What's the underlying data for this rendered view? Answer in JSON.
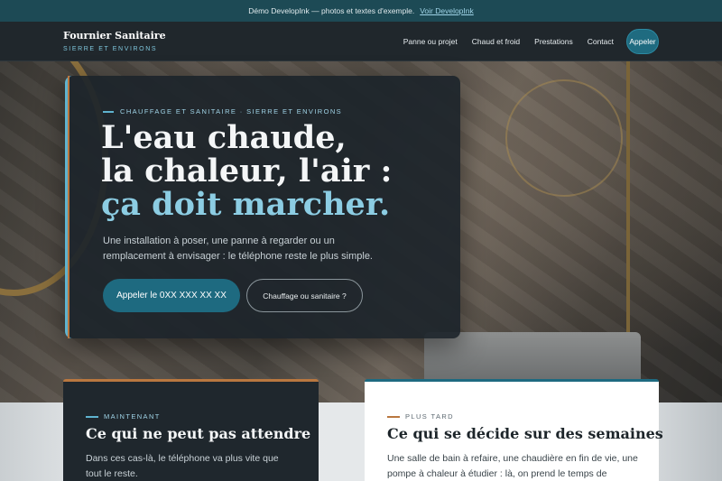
{
  "demo_bar": {
    "text": "Démo DevelopInk — photos et textes d'exemple.",
    "link": "Voir DevelopInk"
  },
  "header": {
    "brand_name": "Fournier Sanitaire",
    "brand_sub": "SIERRE ET ENVIRONS",
    "nav": [
      "Panne ou projet",
      "Chaud et froid",
      "Prestations",
      "Contact"
    ],
    "call_label": "Appeler"
  },
  "hero": {
    "eyebrow": "CHAUFFAGE ET SANITAIRE · SIERRE ET ENVIRONS",
    "title_line1": "L'eau chaude,",
    "title_line2": "la chaleur, l'air :",
    "title_accent": "ça doit marcher.",
    "lead": "Une installation à poser, une panne à regarder ou un remplacement à envisager : le téléphone reste le plus simple.",
    "primary_cta": "Appeler le 0XX XXX XX XX",
    "secondary_cta": "Chauffage ou sanitaire ?"
  },
  "cards": [
    {
      "eyebrow": "MAINTENANT",
      "title": "Ce qui ne peut pas attendre",
      "text": "Dans ces cas-là, le téléphone va plus vite que tout le reste."
    },
    {
      "eyebrow": "PLUS TARD",
      "title": "Ce qui se décide sur des semaines",
      "text": "Une salle de bain à refaire, une chaudière en fin de vie, une pompe à chaleur à étudier : là, on prend le temps de"
    }
  ],
  "colors": {
    "accent_teal": "#1e6a80",
    "accent_light_blue": "#8ccde3",
    "accent_copper": "#b9773f",
    "dark_bg": "#1f272d"
  }
}
